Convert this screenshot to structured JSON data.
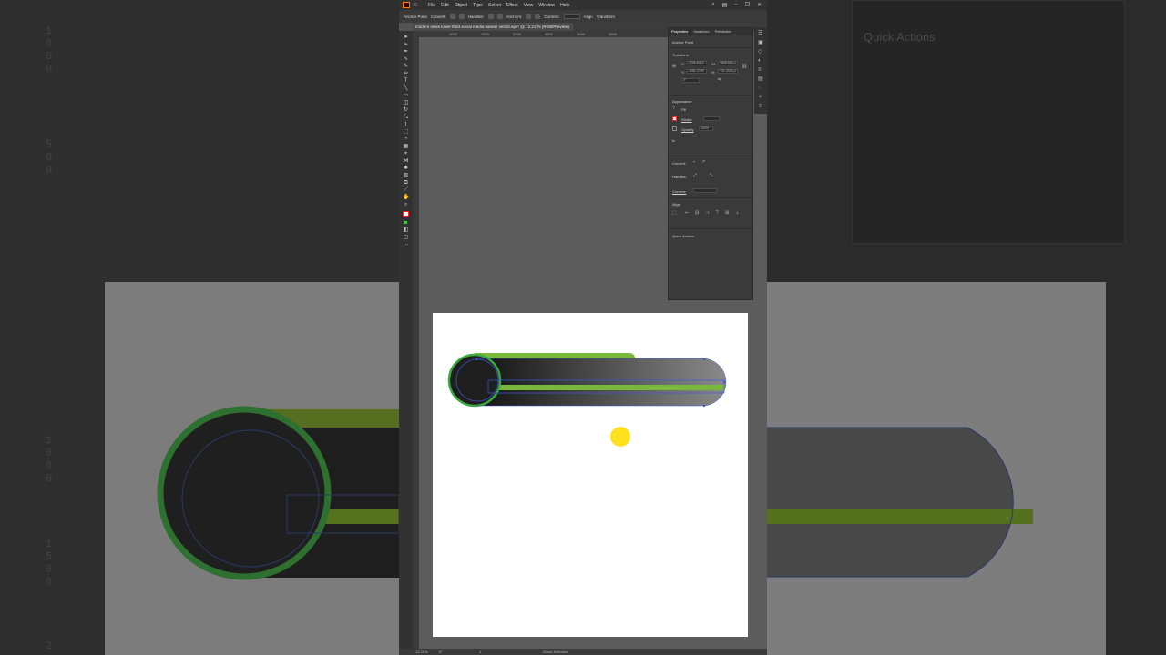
{
  "app": {
    "window_title": "Adobe Illustrator",
    "menu": [
      "File",
      "Edit",
      "Object",
      "Type",
      "Select",
      "Effect",
      "View",
      "Window",
      "Help"
    ]
  },
  "control_bar": {
    "anchor_label": "Anchor Point",
    "convert_label": "Convert:",
    "handles_label": "Handles:",
    "anchors_label": "Anchors:",
    "corners_label": "Corners:",
    "align_label": "Align",
    "transform_label": "Transform"
  },
  "document": {
    "tab_title": "modern news lower third social media banner vector.eps* @ 12.21 % (RGB/Preview)"
  },
  "ruler_ticks": [
    "1000",
    "1500",
    "2000",
    "2500",
    "3000",
    "3500"
  ],
  "properties_panel": {
    "tabs": [
      "Properties",
      "Swatches",
      "Pathfinder"
    ],
    "active_tab": "Properties",
    "selection_type": "Anchor Point",
    "transform_title": "Transform",
    "x_label": "X:",
    "x_value": "2206.6419",
    "y_label": "Y:",
    "y_value": "1081.2789",
    "w_label": "W:",
    "w_value": "3668.656 p",
    "h_label": "H:",
    "h_value": "731.2926 p",
    "angle_value": "0°",
    "appearance_title": "Appearance",
    "fill_label": "Fill",
    "stroke_label": "Stroke",
    "opacity_label": "Opacity",
    "opacity_value": "100%",
    "fx_label": "fx",
    "convert_label": "Convert:",
    "handles_label": "Handles:",
    "corners_label": "Corners:",
    "align_title": "Align",
    "quick_actions_title": "Quick Actions"
  },
  "background_panel": {
    "quick_actions_title": "Quick Actions"
  },
  "background_ruler": [
    "1",
    "0",
    "0",
    "0",
    "5",
    "0",
    "0",
    "1",
    "0",
    "0",
    "0",
    "1",
    "5",
    "0",
    "0",
    "2"
  ],
  "status_bar": {
    "zoom": "12.21%",
    "rotation": "0°",
    "artboard": "1",
    "tool": "Direct Selection"
  },
  "artwork": {
    "accent_green": "#7ab83a",
    "ring_green": "#3aa83f",
    "dark_fill": "#1e1e1e",
    "gradient_end": "#8a8a8a",
    "cursor_highlight": "#ffe21c",
    "path_color": "#3b5bd6"
  }
}
